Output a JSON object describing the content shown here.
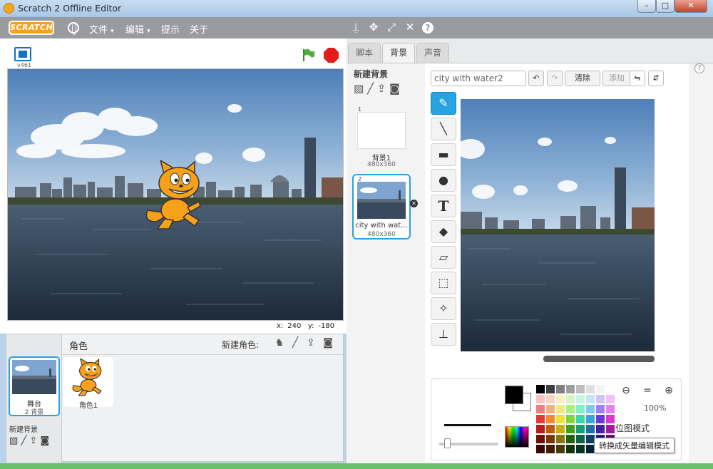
{
  "window": {
    "title": "Scratch 2 Offline Editor",
    "min_symbol": "–",
    "max_symbol": "□",
    "close_symbol": "✕"
  },
  "menubar": {
    "logo": "SCRATCH",
    "file": "文件",
    "edit": "编辑",
    "tips": "提示",
    "about": "关于",
    "caret": "▾",
    "icons": [
      "duplicate-stamp-icon",
      "cut-icon",
      "grow-icon",
      "shrink-icon",
      "help-icon"
    ],
    "help_symbol": "?"
  },
  "stage": {
    "version": "v461",
    "coords": {
      "x_label": "x:",
      "x": "240",
      "y_label": "y:",
      "y": "-180"
    }
  },
  "sprite_pane": {
    "stage_label": "舞台",
    "stage_backdrop_count": "2 背景",
    "new_backdrop": "新建背景",
    "sprites_header": "角色",
    "new_sprite": "新建角色:",
    "sprites": [
      {
        "name": "角色1"
      }
    ]
  },
  "editor": {
    "tabs": [
      "脚本",
      "背景",
      "声音"
    ],
    "active_tab": "背景",
    "new_backdrop_title": "新建背景",
    "backdrops": [
      {
        "num": "1",
        "name": "背景1",
        "size": "480x360"
      },
      {
        "num": "2",
        "name": "city with wat...",
        "size": "480x360"
      }
    ],
    "costume_name": "city with water2",
    "clear": "清除",
    "add": "添加",
    "undo_symbol": "↶",
    "redo_symbol": "↷",
    "paint_tools": [
      "paintbrush-icon",
      "line-icon",
      "rectangle-icon",
      "ellipse-icon",
      "text-icon",
      "fill-icon",
      "eraser-icon",
      "select-icon",
      "magic-wand-icon",
      "stamp-icon"
    ],
    "text_tool_glyph": "T",
    "zoom_level": "100%",
    "mode_label": "位图模式",
    "tooltip": "转换成矢量编辑模式"
  },
  "colors": {
    "palette": [
      "#000000",
      "#3f3f3f",
      "#7f7f7f",
      "#9f9f9f",
      "#bfbfbf",
      "#dfdfdf",
      "#f3f3f3",
      "#ffffff",
      "#f6c3c3",
      "#f6d6c3",
      "#f6f0c3",
      "#d6f6c3",
      "#c3f6e4",
      "#c3e4f6",
      "#d1c3f6",
      "#f0c3f6",
      "#f08080",
      "#f0b080",
      "#f0e880",
      "#a8f080",
      "#80f0c8",
      "#80c8f0",
      "#a080f0",
      "#e880f0",
      "#e53935",
      "#ef8b2c",
      "#f1df3a",
      "#7cd83a",
      "#3ad8a6",
      "#3aa4d8",
      "#6a3ad8",
      "#d83ad0",
      "#b71c1c",
      "#c05a12",
      "#c7b016",
      "#3f9e1d",
      "#169e77",
      "#1d6fa6",
      "#44219e",
      "#a5199c",
      "#6e0f0f",
      "#7a360a",
      "#857510",
      "#22610f",
      "#0f6149",
      "#103f63",
      "#2a1463",
      "#631063",
      "#3a0707",
      "#401c05",
      "#443c06",
      "#123307",
      "#073326",
      "#081f33",
      "#160a33",
      "#330733"
    ],
    "accent": "#26a3e0"
  }
}
